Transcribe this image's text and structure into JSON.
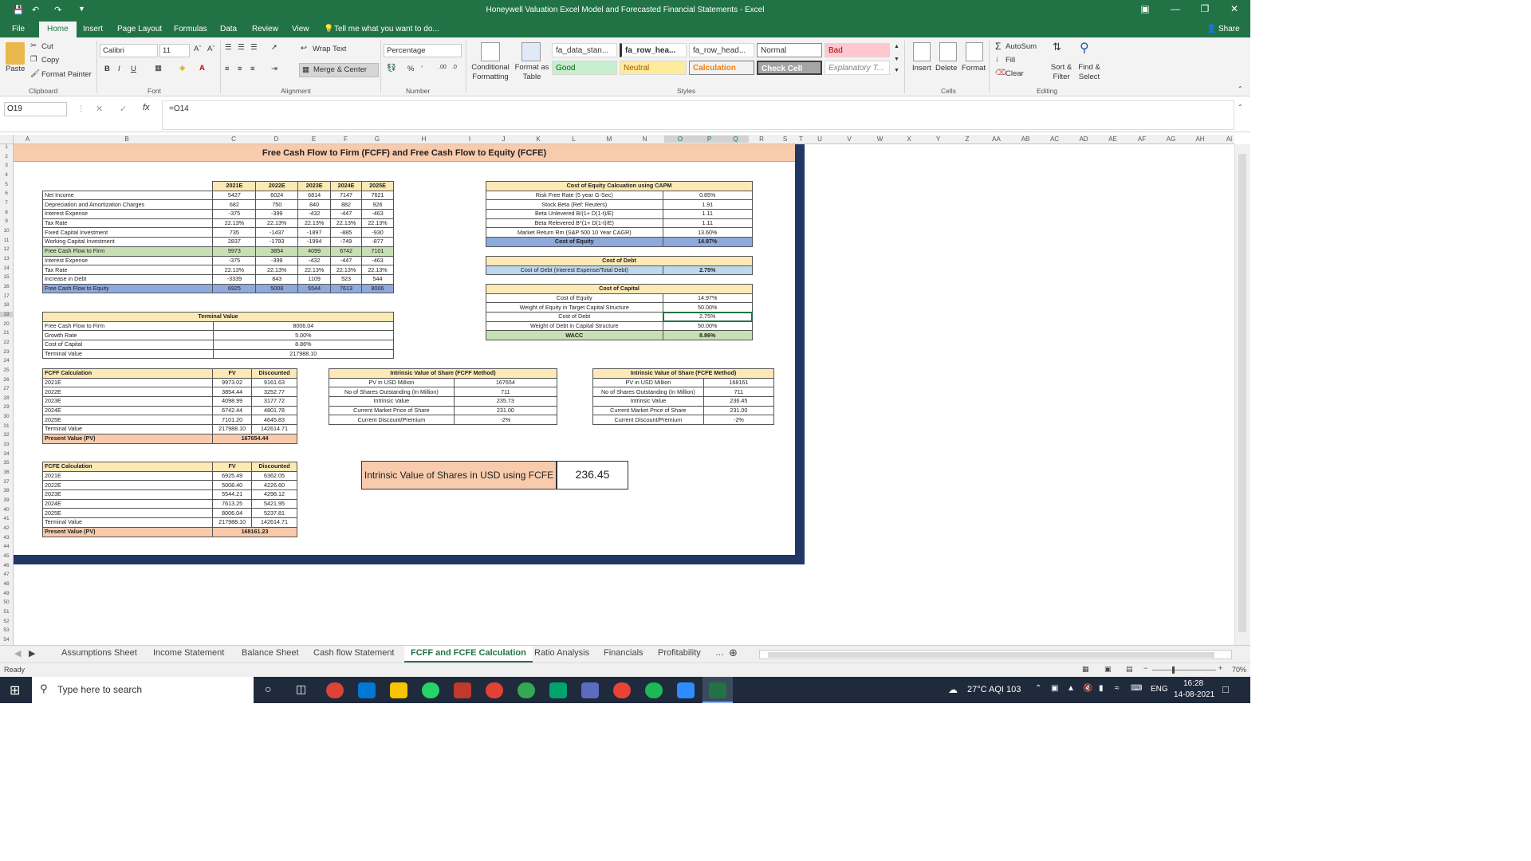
{
  "window": {
    "title": "Honeywell Valuation Excel Model and Forecasted Financial Statements - Excel",
    "share": "Share"
  },
  "menu": [
    "File",
    "Home",
    "Insert",
    "Page Layout",
    "Formulas",
    "Data",
    "Review",
    "View"
  ],
  "tellme": "Tell me what you want to do...",
  "ribbon": {
    "clipboard": {
      "paste": "Paste",
      "cut": "Cut",
      "copy": "Copy",
      "format_painter": "Format Painter",
      "group": "Clipboard"
    },
    "font": {
      "name": "Calibri",
      "size": "11",
      "group": "Font"
    },
    "alignment": {
      "wrap": "Wrap Text",
      "merge": "Merge & Center",
      "group": "Alignment"
    },
    "number": {
      "format": "Percentage",
      "group": "Number"
    },
    "styles": {
      "conditional": "Conditional Formatting",
      "format_table": "Format as Table",
      "cells": [
        "fa_data_stan...",
        "fa_row_hea...",
        "fa_row_head...",
        "Normal",
        "Bad",
        "Good",
        "Neutral",
        "Calculation",
        "Check Cell",
        "Explanatory T..."
      ],
      "group": "Styles"
    },
    "cells": {
      "insert": "Insert",
      "delete": "Delete",
      "format": "Format",
      "group": "Cells"
    },
    "editing": {
      "autosum": "AutoSum",
      "fill": "Fill",
      "clear": "Clear",
      "sort": "Sort & Filter",
      "find": "Find & Select",
      "group": "Editing"
    }
  },
  "formula_bar": {
    "name_box": "O19",
    "formula": "=O14"
  },
  "columns": [
    "A",
    "B",
    "C",
    "D",
    "E",
    "F",
    "G",
    "H",
    "I",
    "J",
    "K",
    "L",
    "M",
    "N",
    "O",
    "P",
    "Q",
    "R",
    "S",
    "T",
    "U",
    "V",
    "W",
    "X",
    "Y",
    "Z",
    "AA",
    "AB",
    "AC",
    "AD",
    "AE",
    "AF",
    "AG",
    "AH",
    "AI"
  ],
  "sheet": {
    "title": "Free Cash Flow to Firm (FCFF) and Free Cash Flow to Equity (FCFE)",
    "main_table": {
      "headers": [
        "2021E",
        "2022E",
        "2023E",
        "2024E",
        "2025E"
      ],
      "rows": [
        {
          "label": "Net Income",
          "values": [
            "5427",
            "6024",
            "6814",
            "7147",
            "7621"
          ]
        },
        {
          "label": "Depreciation and Amortization Charges",
          "values": [
            "682",
            "750",
            "840",
            "882",
            "926"
          ]
        },
        {
          "label": "Interest Expense",
          "values": [
            "-375",
            "-399",
            "-432",
            "-447",
            "-463"
          ]
        },
        {
          "label": "Tax Rate",
          "values": [
            "22.13%",
            "22.13%",
            "22.13%",
            "22.13%",
            "22.13%"
          ]
        },
        {
          "label": "Fixed Capital Investment",
          "values": [
            "735",
            "-1437",
            "-1897",
            "-885",
            "-930"
          ]
        },
        {
          "label": "Working Capital Investment",
          "values": [
            "2837",
            "-1793",
            "-1994",
            "-749",
            "-877"
          ]
        },
        {
          "label": "Free Cash Flow to Firm",
          "values": [
            "9973",
            "3854",
            "4099",
            "6742",
            "7101"
          ]
        },
        {
          "label": "Interest Expense",
          "values": [
            "-375",
            "-399",
            "-432",
            "-447",
            "-463"
          ]
        },
        {
          "label": "Tax Rate",
          "values": [
            "22.13%",
            "22.13%",
            "22.13%",
            "22.13%",
            "22.13%"
          ]
        },
        {
          "label": "Increase in Debt",
          "values": [
            "-3339",
            "843",
            "1109",
            "523",
            "544"
          ]
        },
        {
          "label": "Free Cash Flow to Equity",
          "values": [
            "6925",
            "5008",
            "5544",
            "7613",
            "8006"
          ]
        }
      ]
    },
    "capm": {
      "title": "Cost of Equity Calcuation using CAPM",
      "rows": [
        {
          "label": "Risk Free Rate (5 year G-Sec)",
          "value": "0.85%"
        },
        {
          "label": "Stock Beta (Ref: Reuters)",
          "value": "1.91"
        },
        {
          "label": "Beta Unlevered B/(1+ D(1-t)/E)",
          "value": "1.11"
        },
        {
          "label": "Beta Relevered B*(1+ D(1-t)/E)",
          "value": "1.11"
        },
        {
          "label": "Market Return Rm (S&P 500 10 Year CAGR)",
          "value": "13.60%"
        },
        {
          "label": "Cost of Equity",
          "value": "14.97%"
        }
      ]
    },
    "cost_debt": {
      "title": "Cost of Debt",
      "label": "Cost of Debt (Interest Expense/Total Debt)",
      "value": "2.75%"
    },
    "capital": {
      "title": "Cost of Capital",
      "rows": [
        {
          "label": "Cost of Equity",
          "value": "14.97%"
        },
        {
          "label": "Weight of Equity in Target Capital Structure",
          "value": "50.00%"
        },
        {
          "label": "Cost of Debt",
          "value": "2.75%"
        },
        {
          "label": "Weight of Debt in Capital Structure",
          "value": "50.00%"
        },
        {
          "label": "WACC",
          "value": "8.86%"
        }
      ]
    },
    "terminal": {
      "title": "Terminal Value",
      "rows": [
        {
          "label": "Free Cash Flow to Firm",
          "value": "8006.04"
        },
        {
          "label": "Growth Rate",
          "value": "5.00%"
        },
        {
          "label": "Cost of Capital",
          "value": "8.86%"
        },
        {
          "label": "Terminal Value",
          "value": "217988.10"
        }
      ]
    },
    "fcff_calc": {
      "headers": [
        "FCFF Calculation",
        "FV",
        "Discounted"
      ],
      "rows": [
        [
          "2021E",
          "9973.02",
          "9161.63"
        ],
        [
          "2022E",
          "3854.44",
          "3252.77"
        ],
        [
          "2023E",
          "4098.99",
          "3177.72"
        ],
        [
          "2024E",
          "6742.44",
          "4801.78"
        ],
        [
          "2025E",
          "7101.20",
          "4645.83"
        ],
        [
          "Terminal Value",
          "217988.10",
          "142614.71"
        ]
      ],
      "pv_label": "Present Value (PV)",
      "pv": "167654.44"
    },
    "fcfe_calc": {
      "headers": [
        "FCFE Calculation",
        "FV",
        "Discounted"
      ],
      "rows": [
        [
          "2021E",
          "6925.49",
          "6362.05"
        ],
        [
          "2022E",
          "5008.40",
          "4226.60"
        ],
        [
          "2023E",
          "5544.21",
          "4298.12"
        ],
        [
          "2024E",
          "7613.25",
          "5421.95"
        ],
        [
          "2025E",
          "8006.04",
          "5237.81"
        ],
        [
          "Terminal Value",
          "217988.10",
          "142614.71"
        ]
      ],
      "pv_label": "Present Value (PV)",
      "pv": "168161.23"
    },
    "iv_fcff": {
      "title": "Intrinsic Value of Share (FCFF Method)",
      "rows": [
        {
          "label": "PV in USD Million",
          "value": "167654"
        },
        {
          "label": "No of Shares Outstanding (In Million)",
          "value": "711"
        },
        {
          "label": "Intrinsic Value",
          "value": "235.73"
        },
        {
          "label": "Current Market Price of Share",
          "value": "231.00"
        },
        {
          "label": "Current Discount/Premium",
          "value": "-2%"
        }
      ]
    },
    "iv_fcfe": {
      "title": "Intrinsic Value of Share (FCFE Method)",
      "rows": [
        {
          "label": "PV in USD Million",
          "value": "168161"
        },
        {
          "label": "No of Shares Outstanding (In Million)",
          "value": "711"
        },
        {
          "label": "Intrinsic Value",
          "value": "236.45"
        },
        {
          "label": "Current Market Price of Share",
          "value": "231.00"
        },
        {
          "label": "Current Discount/Premium",
          "value": "-2%"
        }
      ]
    },
    "highlight": {
      "label": "Intrinsic Value of Shares in USD using FCFE",
      "value": "236.45"
    }
  },
  "tabs": [
    "Assumptions Sheet",
    "Income Statement",
    "Balance Sheet",
    "Cash flow Statement",
    "FCFF and FCFE Calculation",
    "Ratio Analysis",
    "Financials",
    "Profitability"
  ],
  "status": {
    "ready": "Ready",
    "zoom": "70%"
  },
  "taskbar": {
    "search": "Type here to search",
    "weather": "27°C  AQI 103",
    "lang": "ENG",
    "time": "16:28",
    "date": "14-08-2021"
  }
}
